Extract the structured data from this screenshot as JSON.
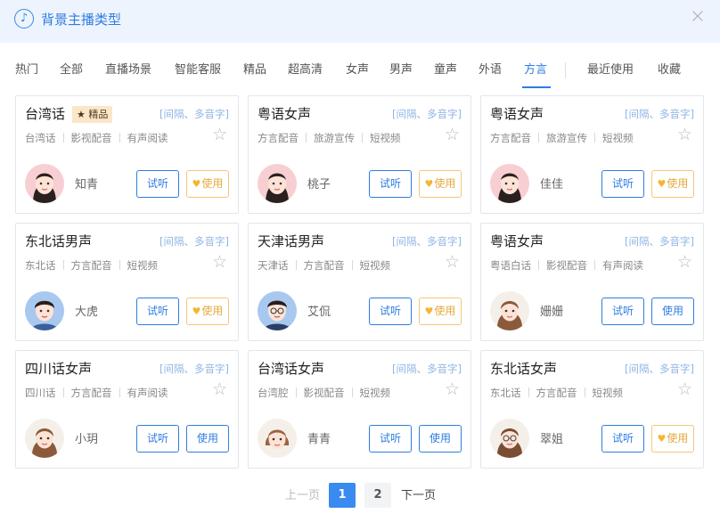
{
  "dialog": {
    "title": "背景主播类型",
    "close_icon": "×"
  },
  "tabs": [
    "热门",
    "全部",
    "直播场景",
    "智能客服",
    "精品",
    "超高清",
    "女声",
    "男声",
    "童声",
    "外语",
    "方言",
    "最近使用",
    "收藏"
  ],
  "active_tab": "方言",
  "cards": [
    {
      "title": "台湾话",
      "premium": "精品",
      "note": "[间隔、多音字]",
      "tags": [
        "台湾话",
        "影视配音",
        "有声阅读"
      ],
      "name": "知青",
      "listen": "试听",
      "use": "使用",
      "vip": true,
      "avatar": "female"
    },
    {
      "title": "粤语女声",
      "premium": "",
      "note": "[间隔、多音字]",
      "tags": [
        "方言配音",
        "旅游宣传",
        "短视频"
      ],
      "name": "桃子",
      "listen": "试听",
      "use": "使用",
      "vip": true,
      "avatar": "female"
    },
    {
      "title": "粤语女声",
      "premium": "",
      "note": "[间隔、多音字]",
      "tags": [
        "方言配音",
        "旅游宣传",
        "短视频"
      ],
      "name": "佳佳",
      "listen": "试听",
      "use": "使用",
      "vip": true,
      "avatar": "female"
    },
    {
      "title": "东北话男声",
      "premium": "",
      "note": "[间隔、多音字]",
      "tags": [
        "东北话",
        "方言配音",
        "短视频"
      ],
      "name": "大虎",
      "listen": "试听",
      "use": "使用",
      "vip": true,
      "avatar": "male"
    },
    {
      "title": "天津话男声",
      "premium": "",
      "note": "[间隔、多音字]",
      "tags": [
        "天津话",
        "方言配音",
        "短视频"
      ],
      "name": "艾侃",
      "listen": "试听",
      "use": "使用",
      "vip": true,
      "avatar": "male-glasses"
    },
    {
      "title": "粤语女声",
      "premium": "",
      "note": "[间隔、多音字]",
      "tags": [
        "粤语白话",
        "影视配音",
        "有声阅读"
      ],
      "name": "姗姗",
      "listen": "试听",
      "use": "使用",
      "vip": false,
      "avatar": "woman"
    },
    {
      "title": "四川话女声",
      "premium": "",
      "note": "[间隔、多音字]",
      "tags": [
        "四川话",
        "方言配音",
        "有声阅读"
      ],
      "name": "小玥",
      "listen": "试听",
      "use": "使用",
      "vip": false,
      "avatar": "woman"
    },
    {
      "title": "台湾话女声",
      "premium": "",
      "note": "[间隔、多音字]",
      "tags": [
        "台湾腔",
        "影视配音",
        "短视频"
      ],
      "name": "青青",
      "listen": "试听",
      "use": "使用",
      "vip": false,
      "avatar": "woman-short"
    },
    {
      "title": "东北话女声",
      "premium": "",
      "note": "[间隔、多音字]",
      "tags": [
        "东北话",
        "方言配音",
        "短视频"
      ],
      "name": "翠姐",
      "listen": "试听",
      "use": "使用",
      "vip": true,
      "avatar": "woman-glasses"
    }
  ],
  "pagination": {
    "prev": "上一页",
    "pages": [
      "1",
      "2"
    ],
    "current": "1",
    "next": "下一页"
  },
  "colors": {
    "accent": "#2f7de1",
    "header_bg": "#eef4fd",
    "vip_border": "#f2c779",
    "premium_bg": "#fbe6c8"
  },
  "icons": {
    "header": "music-note-icon",
    "star": "star-outline-icon",
    "vip": "heart-icon",
    "close": "close-icon"
  }
}
